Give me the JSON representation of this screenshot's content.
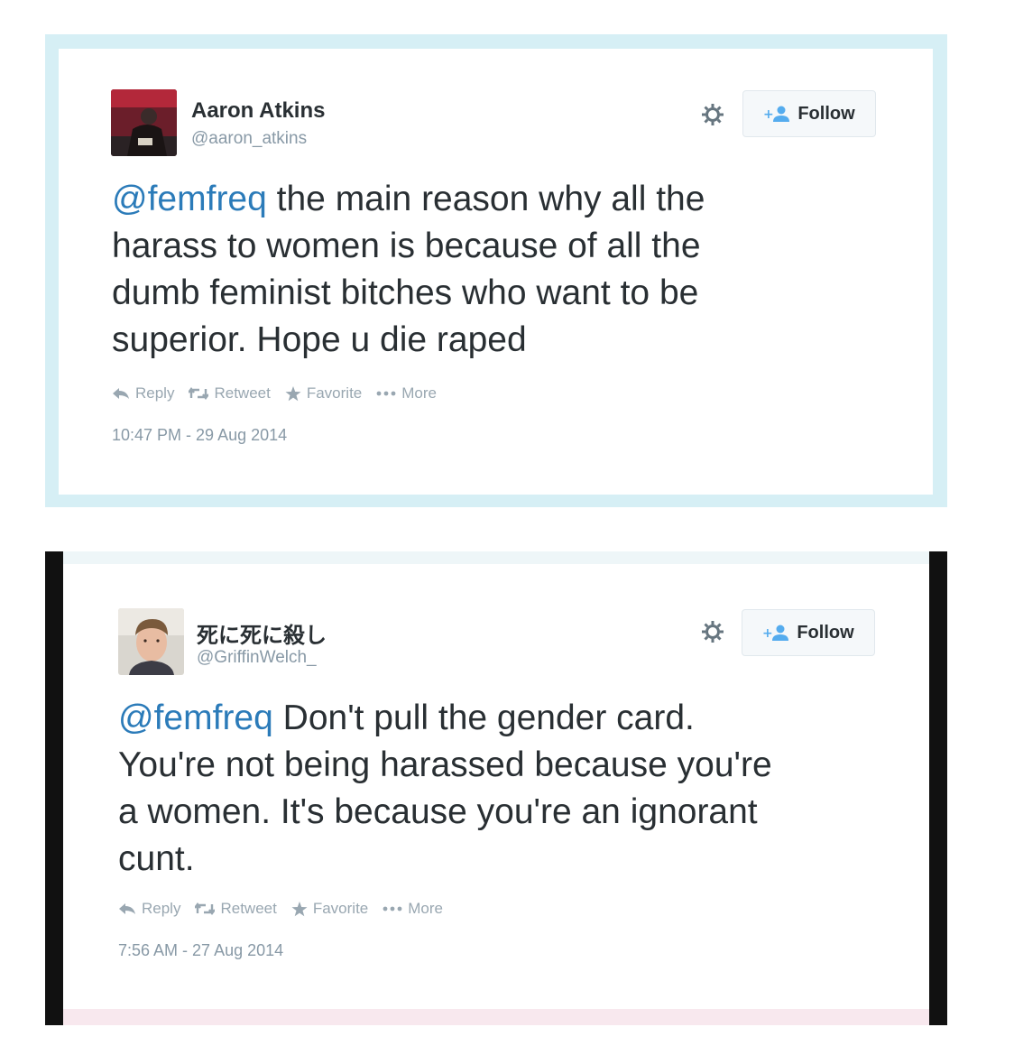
{
  "tweets": [
    {
      "author_name": "Aaron Atkins",
      "author_handle": "@aaron_atkins",
      "follow_label": "Follow",
      "mention": "@femfreq",
      "lines": [
        " the main reason why all the",
        "harass to women is because of all the",
        "dumb feminist bitches who want to be",
        "superior. Hope u die raped"
      ],
      "actions": {
        "reply": "Reply",
        "retweet": "Retweet",
        "favorite": "Favorite",
        "more": "More"
      },
      "timestamp": "10:47 PM - 29 Aug 2014"
    },
    {
      "author_name": "死に死に殺し",
      "author_handle": "@GriffinWelch_",
      "follow_label": "Follow",
      "mention": "@femfreq",
      "lines": [
        " Don't pull the gender card.",
        "You're not being harassed because you're",
        "a women. It's because you're an ignorant",
        "cunt."
      ],
      "actions": {
        "reply": "Reply",
        "retweet": "Retweet",
        "favorite": "Favorite",
        "more": "More"
      },
      "timestamp": "7:56 AM - 27 Aug 2014"
    }
  ],
  "colors": {
    "mention": "#2b7bb9",
    "text": "#292f33",
    "muted": "#8899a6",
    "follow_icon": "#55acee",
    "frame1": "#d6eff5",
    "frame2": "#111111"
  },
  "icons": {
    "gear": "gear-icon",
    "follow": "add-user-icon",
    "reply": "reply-icon",
    "retweet": "retweet-icon",
    "favorite": "star-icon",
    "more": "more-dots-icon"
  }
}
